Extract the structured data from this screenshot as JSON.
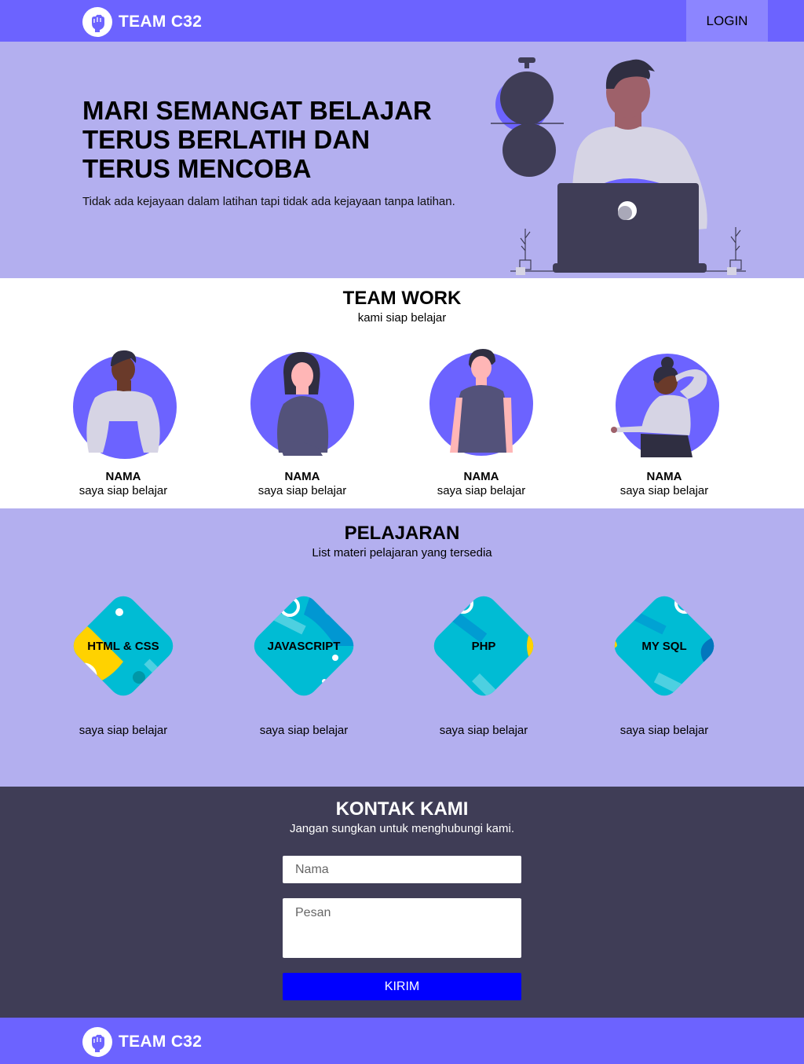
{
  "navbar": {
    "brand": "TEAM C32",
    "login_label": "LOGIN",
    "logo_icon": "fist-icon"
  },
  "hero": {
    "title_lines": [
      "MARI SEMANGAT BELAJAR",
      "TERUS BERLATIH DAN",
      "TERUS MENCOBA"
    ],
    "subtitle": "Tidak ada kejayaan dalam latihan tapi tidak ada kejayaan tanpa latihan."
  },
  "team": {
    "title": "TEAM WORK",
    "subtitle": "kami siap belajar",
    "members": [
      {
        "name": "NAMA",
        "desc": "saya siap belajar"
      },
      {
        "name": "NAMA",
        "desc": "saya siap belajar"
      },
      {
        "name": "NAMA",
        "desc": "saya siap belajar"
      },
      {
        "name": "NAMA",
        "desc": "saya siap belajar"
      }
    ]
  },
  "lessons": {
    "title": "PELAJARAN",
    "subtitle": "List materi pelajaran yang tersedia",
    "courses": [
      {
        "label": "HTML & CSS",
        "desc": "saya siap belajar"
      },
      {
        "label": "JAVASCRIPT",
        "desc": "saya siap belajar"
      },
      {
        "label": "PHP",
        "desc": "saya siap belajar"
      },
      {
        "label": "MY SQL",
        "desc": "saya siap belajar"
      }
    ]
  },
  "contact": {
    "title": "KONTAK KAMI",
    "subtitle": "Jangan sungkan untuk menghubungi kami.",
    "name_placeholder": "Nama",
    "message_placeholder": "Pesan",
    "submit_label": "KIRIM"
  },
  "footer": {
    "brand": "TEAM C32"
  },
  "colors": {
    "primary": "#6c63ff",
    "lavender": "#b3afef",
    "dark": "#3f3d56",
    "submit": "#0000ff",
    "tile": "#00bcd4"
  }
}
